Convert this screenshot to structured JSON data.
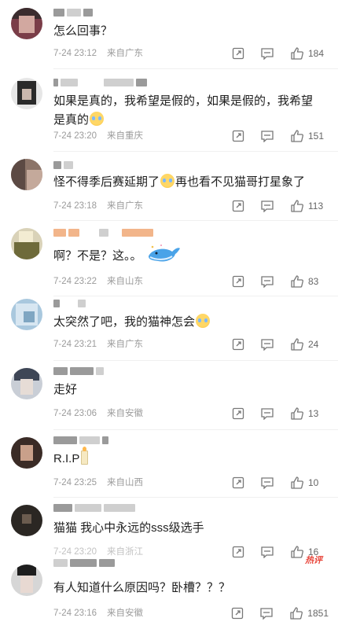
{
  "comments": [
    {
      "text": "怎么回事？",
      "time": "7-24 23:12",
      "loc": "来自广东",
      "likes": "184"
    },
    {
      "text": "如果是真的，我希望是假的，如果是假的，我希望是真的",
      "time": "7-24 23:20",
      "loc": "来自重庆",
      "likes": "151"
    },
    {
      "text": "怪不得季后赛延期了",
      "text2": "再也看不见猫哥打星象了",
      "time": "7-24 23:18",
      "loc": "来自广东",
      "likes": "113"
    },
    {
      "text": "啊？不是？这。。",
      "time": "7-24 23:22",
      "loc": "来自山东",
      "likes": "83"
    },
    {
      "text": "太突然了吧，我的猫神怎会",
      "time": "7-24 23:21",
      "loc": "来自广东",
      "likes": "24"
    },
    {
      "text": "走好",
      "time": "7-24 23:06",
      "loc": "来自安徽",
      "likes": "13"
    },
    {
      "text": "R.I.P",
      "time": "7-24 23:25",
      "loc": "来自山西",
      "likes": "10"
    },
    {
      "text": "猫猫 我心中永远的sss级选手",
      "time": "7-24 23:20",
      "loc": "来自浙江",
      "likes": "16"
    },
    {
      "text": "有人知道什么原因吗？卧槽？？？",
      "time": "7-24 23:16",
      "loc": "来自安徽",
      "likes": "1851",
      "badge": "热评"
    }
  ],
  "icons": {
    "share": "share-icon",
    "comment": "comment-icon",
    "like": "thumbs-up-icon",
    "emoji_cry": "crying-emoji-icon"
  }
}
